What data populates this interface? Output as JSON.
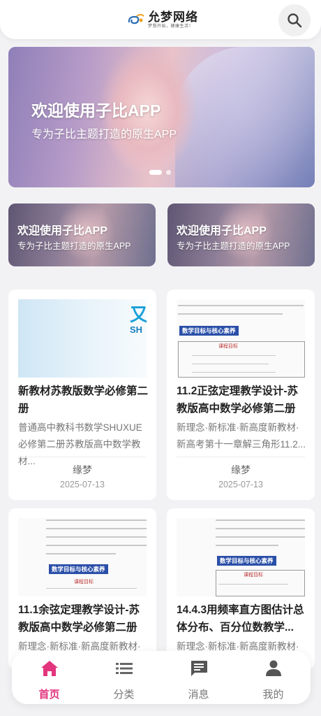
{
  "header": {
    "logo_title": "允梦网络",
    "logo_subtitle": "梦想开始，健康生活！",
    "search_icon": "search-icon"
  },
  "banner": {
    "title": "欢迎使用子比APP",
    "subtitle": "专为子比主题打造的原生APP",
    "slide_index": 1,
    "slide_count": 2
  },
  "promos": [
    {
      "title": "欢迎使用子比APP",
      "subtitle": "专为子比主题打造的原生APP"
    },
    {
      "title": "欢迎使用子比APP",
      "subtitle": "专为子比主题打造的原生APP"
    }
  ],
  "articles": [
    {
      "title": "新教材苏教版数学必修第二册",
      "desc": "普通高中教科书数学SHUXUE必修第二册苏教版高中数学教材...",
      "author": "缘梦",
      "date": "2025-07-13",
      "thumb_text": [
        "又",
        "SH"
      ]
    },
    {
      "title": "11.2正弦定理教学设计-苏教版高中数学必修第二册",
      "desc": "新理念·新标准·新高度新教材·新高考第十一章解三角形11.2...",
      "author": "缘梦",
      "date": "2025-07-13",
      "thumb_tag": "数学目标与核心素养",
      "thumb_header": "课程目标"
    },
    {
      "title": "11.1余弦定理教学设计-苏教版高中数学必修第二册",
      "desc": "新理念·新标准·新高度新教材·",
      "thumb_tag": "数学目标与核心素养",
      "thumb_header": "课程目标"
    },
    {
      "title": "14.4.3用频率直方图估计总体分布、百分位数教学...",
      "desc": "新理念·新标准·新高度新教材·",
      "thumb_tag": "数学目标与核心素养",
      "thumb_header": "课程目标"
    }
  ],
  "nav": {
    "items": [
      {
        "label": "首页",
        "icon": "home-icon",
        "active": true
      },
      {
        "label": "分类",
        "icon": "list-icon",
        "active": false
      },
      {
        "label": "消息",
        "icon": "message-icon",
        "active": false
      },
      {
        "label": "我的",
        "icon": "user-icon",
        "active": false
      }
    ],
    "active_color": "#e2357e",
    "inactive_color": "#777777"
  }
}
